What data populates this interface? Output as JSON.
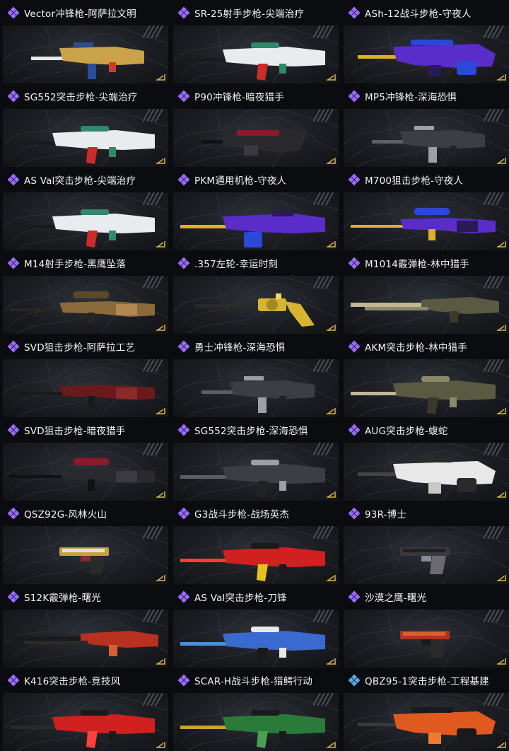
{
  "items": [
    {
      "title": "Vector冲锋枪-阿萨拉文明",
      "rarity": "purple",
      "rarity_color": "#9b6bff",
      "weapon_type": "smg",
      "colors": [
        "#c9a24a",
        "#2a4d9c",
        "#d23b2f",
        "#e8e8e8"
      ]
    },
    {
      "title": "SR-25射手步枪-尖端治疗",
      "rarity": "purple",
      "rarity_color": "#9b6bff",
      "weapon_type": "rifle",
      "colors": [
        "#e9ecef",
        "#2f8a6a",
        "#cc2b2b",
        "#1a1a1a"
      ]
    },
    {
      "title": "ASh-12战斗步枪-守夜人",
      "rarity": "purple",
      "rarity_color": "#9b6bff",
      "weapon_type": "bullpup",
      "colors": [
        "#5a2cc9",
        "#2b48d8",
        "#2a1a55",
        "#e0b020"
      ]
    },
    {
      "title": "SG552突击步枪-尖端治疗",
      "rarity": "purple",
      "rarity_color": "#9b6bff",
      "weapon_type": "rifle",
      "colors": [
        "#e9ecef",
        "#2f8a6a",
        "#cc2b2b",
        "#1a1a1a"
      ]
    },
    {
      "title": "P90冲锋枪-暗夜猎手",
      "rarity": "purple",
      "rarity_color": "#9b6bff",
      "weapon_type": "p90",
      "colors": [
        "#2a2a2e",
        "#8b1a2a",
        "#3a3a40",
        "#111111"
      ]
    },
    {
      "title": "MP5冲锋枪-深海恐惧",
      "rarity": "purple",
      "rarity_color": "#9b6bff",
      "weapon_type": "smg",
      "colors": [
        "#3b3e44",
        "#9aa0a8",
        "#202226",
        "#5b6068"
      ]
    },
    {
      "title": "AS Val突击步枪-尖端治疗",
      "rarity": "purple",
      "rarity_color": "#9b6bff",
      "weapon_type": "rifle",
      "colors": [
        "#e9ecef",
        "#2f8a6a",
        "#cc2b2b",
        "#1a1a1a"
      ]
    },
    {
      "title": "PKM通用机枪-守夜人",
      "rarity": "purple",
      "rarity_color": "#9b6bff",
      "weapon_type": "lmg",
      "colors": [
        "#5a2cc9",
        "#2b48d8",
        "#2a1a55",
        "#e0b020"
      ]
    },
    {
      "title": "M700狙击步枪-守夜人",
      "rarity": "purple",
      "rarity_color": "#9b6bff",
      "weapon_type": "sniper",
      "colors": [
        "#5a2cc9",
        "#2b48d8",
        "#2a1a55",
        "#e0b020"
      ]
    },
    {
      "title": "M14射手步枪-黑鹰坠落",
      "rarity": "purple",
      "rarity_color": "#9b6bff",
      "weapon_type": "sniper",
      "colors": [
        "#8a6a3a",
        "#5a4a2a",
        "#b08850",
        "#2a2520"
      ]
    },
    {
      "title": ".357左轮-幸运时刻",
      "rarity": "purple",
      "rarity_color": "#9b6bff",
      "weapon_type": "revolver",
      "colors": [
        "#d8b530",
        "#a88620",
        "#f0d860",
        "#2a2a2a"
      ]
    },
    {
      "title": "M1014霰弹枪-林中猎手",
      "rarity": "purple",
      "rarity_color": "#9b6bff",
      "weapon_type": "shotgun",
      "colors": [
        "#5a5a42",
        "#8a8a6a",
        "#3a3a2a",
        "#c0b890"
      ]
    },
    {
      "title": "SVD狙击步枪-阿萨拉工艺",
      "rarity": "purple",
      "rarity_color": "#9b6bff",
      "weapon_type": "sniper",
      "colors": [
        "#6a1a1a",
        "#2a2a2e",
        "#8a2a2a",
        "#1a1a1a"
      ]
    },
    {
      "title": "勇士冲锋枪-深海恐惧",
      "rarity": "purple",
      "rarity_color": "#9b6bff",
      "weapon_type": "smg",
      "colors": [
        "#3b3e44",
        "#9aa0a8",
        "#202226",
        "#5b6068"
      ]
    },
    {
      "title": "AKM突击步枪-林中猎手",
      "rarity": "purple",
      "rarity_color": "#9b6bff",
      "weapon_type": "rifle",
      "colors": [
        "#5a5a42",
        "#8a8a6a",
        "#3a3a2a",
        "#c0b890"
      ]
    },
    {
      "title": "SVD狙击步枪-暗夜猎手",
      "rarity": "purple",
      "rarity_color": "#9b6bff",
      "weapon_type": "sniper",
      "colors": [
        "#2a2a2e",
        "#8b1a2a",
        "#3a3a40",
        "#111111"
      ]
    },
    {
      "title": "SG552突击步枪-深海恐惧",
      "rarity": "purple",
      "rarity_color": "#9b6bff",
      "weapon_type": "rifle",
      "colors": [
        "#3b3e44",
        "#9aa0a8",
        "#202226",
        "#5b6068"
      ]
    },
    {
      "title": "AUG突击步枪-蝮蛇",
      "rarity": "purple",
      "rarity_color": "#9b6bff",
      "weapon_type": "bullpup",
      "colors": [
        "#e8e8e8",
        "#2a2a2a",
        "#c8c8c8",
        "#444444"
      ]
    },
    {
      "title": "QSZ92G-风林火山",
      "rarity": "purple",
      "rarity_color": "#9b6bff",
      "weapon_type": "pistol",
      "colors": [
        "#c8a040",
        "#2a2a2a",
        "#e0e0e0",
        "#8a2a2a"
      ]
    },
    {
      "title": "G3战斗步枪-战场英杰",
      "rarity": "purple",
      "rarity_color": "#9b6bff",
      "weapon_type": "rifle",
      "colors": [
        "#d02020",
        "#1a1a1a",
        "#e8c020",
        "#ff4030"
      ]
    },
    {
      "title": "93R-博士",
      "rarity": "purple",
      "rarity_color": "#9b6bff",
      "weapon_type": "pistol",
      "colors": [
        "#3a3a3e",
        "#6a6a70",
        "#202024",
        "#8a8a90"
      ]
    },
    {
      "title": "S12K霰弹枪-曙光",
      "rarity": "purple",
      "rarity_color": "#9b6bff",
      "weapon_type": "shotgun",
      "colors": [
        "#b83020",
        "#2a2a2a",
        "#d86030",
        "#1a1a1a"
      ]
    },
    {
      "title": "AS Val突击步枪-刀锋",
      "rarity": "purple",
      "rarity_color": "#9b6bff",
      "weapon_type": "rifle",
      "colors": [
        "#3a6ad0",
        "#e8e8e8",
        "#1a1a1a",
        "#4a90e0"
      ]
    },
    {
      "title": "沙漠之鹰-曙光",
      "rarity": "purple",
      "rarity_color": "#9b6bff",
      "weapon_type": "pistol",
      "colors": [
        "#b83020",
        "#2a2a2a",
        "#d86030",
        "#1a1a1a"
      ]
    },
    {
      "title": "K416突击步枪-竞技风",
      "rarity": "purple",
      "rarity_color": "#9b6bff",
      "weapon_type": "rifle",
      "colors": [
        "#d02020",
        "#1a1a1a",
        "#ff4040",
        "#2a2a2a"
      ]
    },
    {
      "title": "SCAR-H战斗步枪-猎鳄行动",
      "rarity": "purple",
      "rarity_color": "#9b6bff",
      "weapon_type": "rifle",
      "colors": [
        "#2a7a3a",
        "#1a1a1a",
        "#4aa050",
        "#d0a030"
      ]
    },
    {
      "title": "QBZ95-1突击步枪-工程基建",
      "rarity": "blue",
      "rarity_color": "#5aa8e8",
      "weapon_type": "bullpup",
      "colors": [
        "#e05a20",
        "#1a1a1a",
        "#f07a30",
        "#3a3a3a"
      ]
    }
  ]
}
